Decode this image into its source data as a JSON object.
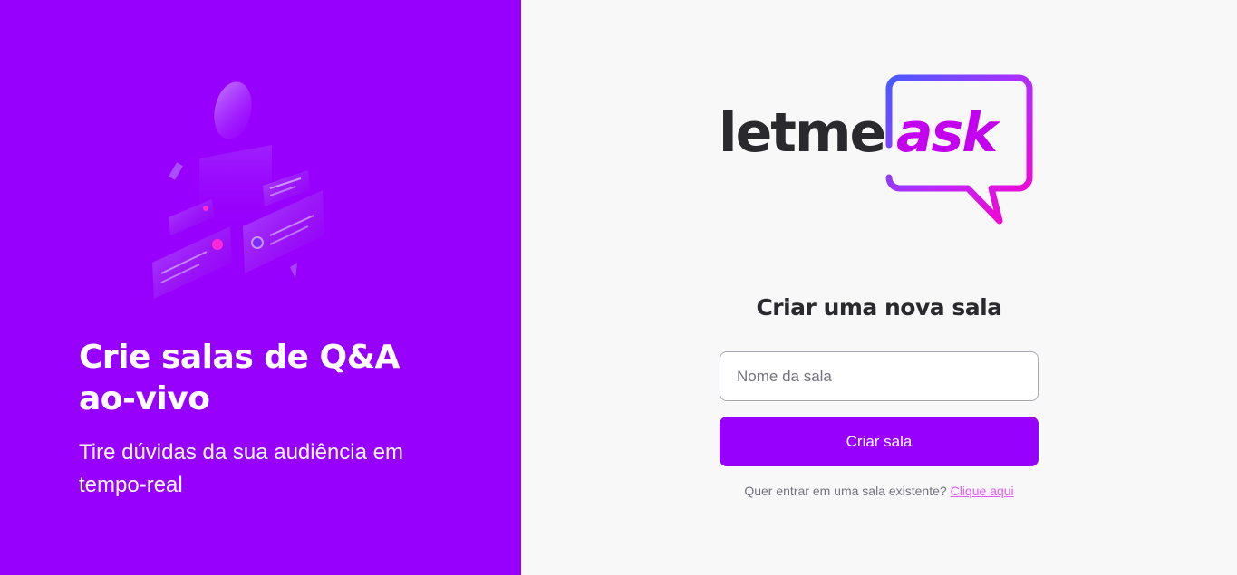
{
  "aside": {
    "illustration_name": "q-and-a-illustration",
    "title": "Crie salas de Q&A ao-vivo",
    "subtitle": "Tire dúvidas da sua audiência em tempo-real",
    "background_color": "#9800fd"
  },
  "logo": {
    "part1": "letme",
    "part2": "ask",
    "text_color": "#29292e",
    "gradient_start": "#485bff",
    "gradient_end": "#ff59f8"
  },
  "form": {
    "title": "Criar uma nova sala",
    "input_placeholder": "Nome da sala",
    "input_value": "",
    "button_label": "Criar sala",
    "join_prompt": "Quer entrar em uma sala existente?",
    "join_link_label": "Clique aqui",
    "accent_color": "#9800fd",
    "link_color": "#e559f9"
  }
}
